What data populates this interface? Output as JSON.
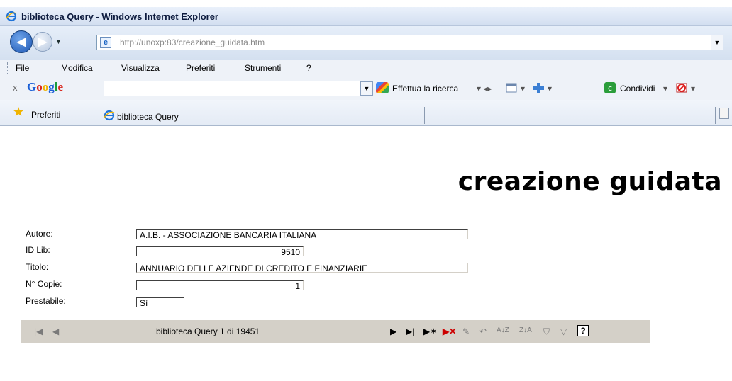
{
  "window": {
    "title": "biblioteca Query - Windows Internet Explorer"
  },
  "address": {
    "url": "http://unoxp:83/creazione_guidata.htm"
  },
  "menu": [
    "File",
    "Modifica",
    "Visualizza",
    "Preferiti",
    "Strumenti",
    "?"
  ],
  "google_toolbar": {
    "close": "x",
    "logo": "Google",
    "search_value": "",
    "search_button": "Effettua la ricerca",
    "share": "Condividi"
  },
  "favorites_bar": {
    "label": "Preferiti",
    "tab_title": "biblioteca Query"
  },
  "page": {
    "title": "creazione guidata",
    "fields": [
      {
        "label": "Autore:",
        "value": "A.I.B. - ASSOCIAZIONE BANCARIA ITALIANA"
      },
      {
        "label": "ID Lib:",
        "value": "9510"
      },
      {
        "label": "Titolo:",
        "value": "ANNUARIO DELLE AZIENDE DI CREDITO E FINANZIARIE"
      },
      {
        "label": "N° Copie:",
        "value": "1"
      },
      {
        "label": "Prestabile:",
        "value": "Sì"
      }
    ],
    "navigation": {
      "record_info": "biblioteca Query 1 di 19451",
      "first": "|◀",
      "prev": "◀",
      "next": "▶",
      "last": "▶|",
      "new": "▶✶",
      "delete": "▶✕",
      "save": "✎",
      "undo": "↶",
      "sort_asc": "A↓Z",
      "sort_desc": "Z↓A",
      "filter_by_selection": "⛉",
      "filter": "▽",
      "help": "?"
    }
  }
}
